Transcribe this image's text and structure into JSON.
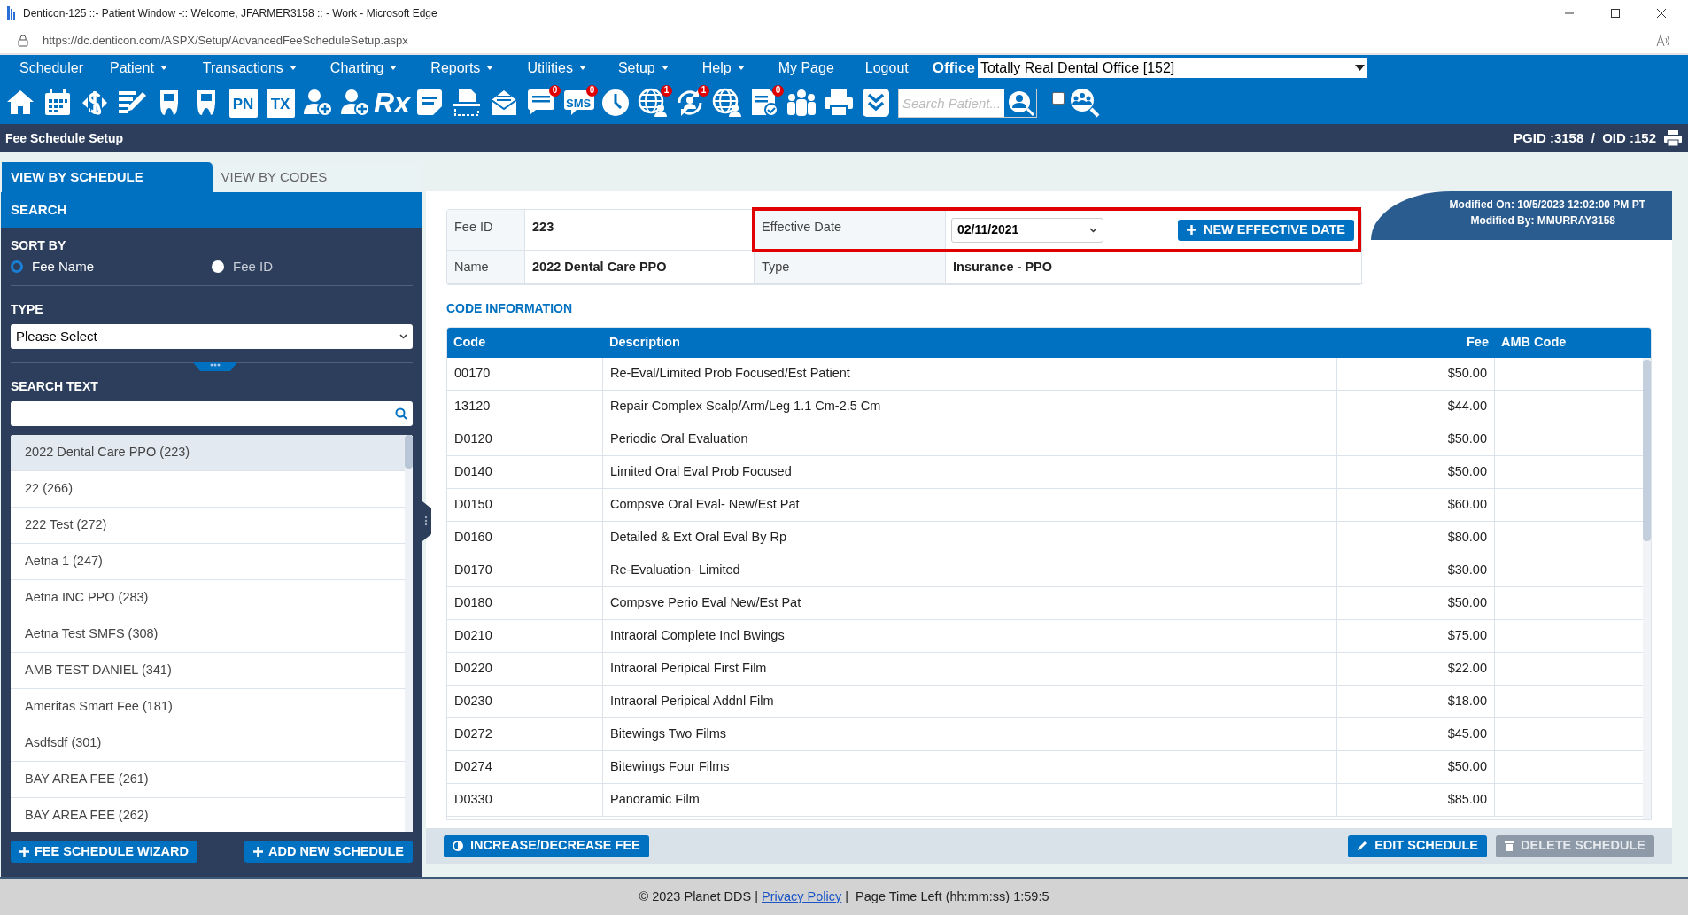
{
  "window": {
    "title": "Denticon-125 ::- Patient Window -:: Welcome, JFARMER3158 :: - Work - Microsoft Edge",
    "url": "https://dc.denticon.com/ASPX/Setup/AdvancedFeeScheduleSetup.aspx"
  },
  "menu": [
    {
      "label": "Scheduler",
      "dropdown": false
    },
    {
      "label": "Patient",
      "dropdown": true
    },
    {
      "label": "Transactions",
      "dropdown": true
    },
    {
      "label": "Charting",
      "dropdown": true
    },
    {
      "label": "Reports",
      "dropdown": true
    },
    {
      "label": "Utilities",
      "dropdown": true
    },
    {
      "label": "Setup",
      "dropdown": true
    },
    {
      "label": "Help",
      "dropdown": true
    },
    {
      "label": "My Page",
      "dropdown": false
    },
    {
      "label": "Logout",
      "dropdown": false
    }
  ],
  "office": {
    "label": "Office",
    "value": "Totally Real Dental Office [152]"
  },
  "toolbar": [
    {
      "kind": "home"
    },
    {
      "kind": "calendar"
    },
    {
      "kind": "dollar"
    },
    {
      "kind": "pencil"
    },
    {
      "kind": "tooth"
    },
    {
      "kind": "tooth"
    },
    {
      "kind": "text",
      "label": "PN"
    },
    {
      "kind": "text",
      "label": "TX"
    },
    {
      "kind": "person-plus"
    },
    {
      "kind": "person-plus"
    },
    {
      "kind": "rx",
      "label": "Rx"
    },
    {
      "kind": "note"
    },
    {
      "kind": "scanner"
    },
    {
      "kind": "envelope"
    },
    {
      "kind": "chat",
      "badge": "0"
    },
    {
      "kind": "sms",
      "label": "SMS",
      "badge": "0"
    },
    {
      "kind": "clock"
    },
    {
      "kind": "globe",
      "badge": "1"
    },
    {
      "kind": "refresh",
      "badge": "1"
    },
    {
      "kind": "globe"
    },
    {
      "kind": "document",
      "badge": "0"
    },
    {
      "kind": "group"
    },
    {
      "kind": "printer"
    },
    {
      "kind": "chevron"
    }
  ],
  "patient_search": {
    "placeholder": "Search Patient...",
    "checkbox_checked": false
  },
  "page_header": {
    "title": "Fee Schedule Setup",
    "ids": "PGID :3158  /  OID :152"
  },
  "tabs": [
    {
      "label": "VIEW BY SCHEDULE",
      "selected": true
    },
    {
      "label": "VIEW BY CODES",
      "selected": false
    }
  ],
  "search_panel": {
    "title": "SEARCH",
    "sort_label": "SORT BY",
    "sort_options": [
      {
        "label": "Fee Name",
        "selected": true
      },
      {
        "label": "Fee ID",
        "selected": false
      }
    ],
    "type_label": "TYPE",
    "type_value": "Please Select",
    "search_label": "SEARCH TEXT",
    "results": [
      {
        "label": "2022 Dental Care PPO (223)",
        "selected": true
      },
      {
        "label": "22 (266)",
        "selected": false
      },
      {
        "label": "222 Test (272)",
        "selected": false
      },
      {
        "label": "Aetna 1 (247)",
        "selected": false
      },
      {
        "label": "Aetna INC PPO (283)",
        "selected": false
      },
      {
        "label": "Aetna Test SMFS (308)",
        "selected": false
      },
      {
        "label": "AMB TEST DANIEL (341)",
        "selected": false
      },
      {
        "label": "Ameritas Smart Fee (181)",
        "selected": false
      },
      {
        "label": "Asdfsdf (301)",
        "selected": false
      },
      {
        "label": "BAY AREA FEE (261)",
        "selected": false
      },
      {
        "label": "BAY AREA FEE (262)",
        "selected": false
      }
    ],
    "buttons": [
      "FEE SCHEDULE WIZARD",
      "ADD NEW SCHEDULE"
    ]
  },
  "schedule": {
    "fee_id_label": "Fee ID",
    "fee_id": "223",
    "effective_date_label": "Effective Date",
    "effective_date": "02/11/2021",
    "new_date_button": "NEW EFFECTIVE DATE",
    "name_label": "Name",
    "name": "2022 Dental Care PPO",
    "type_label": "Type",
    "type": "Insurance - PPO",
    "modified_on": "Modified On: 10/5/2023 12:02:00 PM PT",
    "modified_by": "Modified By: MMURRAY3158"
  },
  "code_information": {
    "title": "CODE INFORMATION",
    "columns": [
      "Code",
      "Description",
      "Fee",
      "AMB Code"
    ],
    "rows": [
      [
        "00170",
        "Re-Eval/Limited Prob Focused/Est Patient",
        "$50.00"
      ],
      [
        "13120",
        "Repair Complex Scalp/Arm/Leg 1.1 Cm-2.5 Cm",
        "$44.00"
      ],
      [
        "D0120",
        "Periodic Oral Evaluation",
        "$50.00"
      ],
      [
        "D0140",
        "Limited Oral Eval Prob Focused",
        "$50.00"
      ],
      [
        "D0150",
        "Compsve Oral Eval- New/Est Pat",
        "$60.00"
      ],
      [
        "D0160",
        "Detailed & Ext Oral Eval By Rp",
        "$80.00"
      ],
      [
        "D0170",
        "Re-Evaluation- Limited",
        "$30.00"
      ],
      [
        "D0180",
        "Compsve Perio Eval New/Est Pat",
        "$50.00"
      ],
      [
        "D0210",
        "Intraoral Complete Incl Bwings",
        "$75.00"
      ],
      [
        "D0220",
        "Intraoral Peripical First Film",
        "$22.00"
      ],
      [
        "D0230",
        "Intraoral Peripical Addnl Film",
        "$18.00"
      ],
      [
        "D0272",
        "Bitewings Two Films",
        "$45.00"
      ],
      [
        "D0274",
        "Bitewings Four Films",
        "$50.00"
      ],
      [
        "D0330",
        "Panoramic Film",
        "$85.00"
      ]
    ]
  },
  "actions": [
    {
      "label": "INCREASE/DECREASE FEE",
      "disabled": false
    },
    {
      "label": "EDIT SCHEDULE",
      "disabled": false
    },
    {
      "label": "DELETE SCHEDULE",
      "disabled": true
    }
  ],
  "footer": {
    "copyright": "© 2023 Planet DDS |",
    "link": "Privacy Policy",
    "time_left": "|  Page Time Left (hh:mm:ss) 1:59:5"
  }
}
